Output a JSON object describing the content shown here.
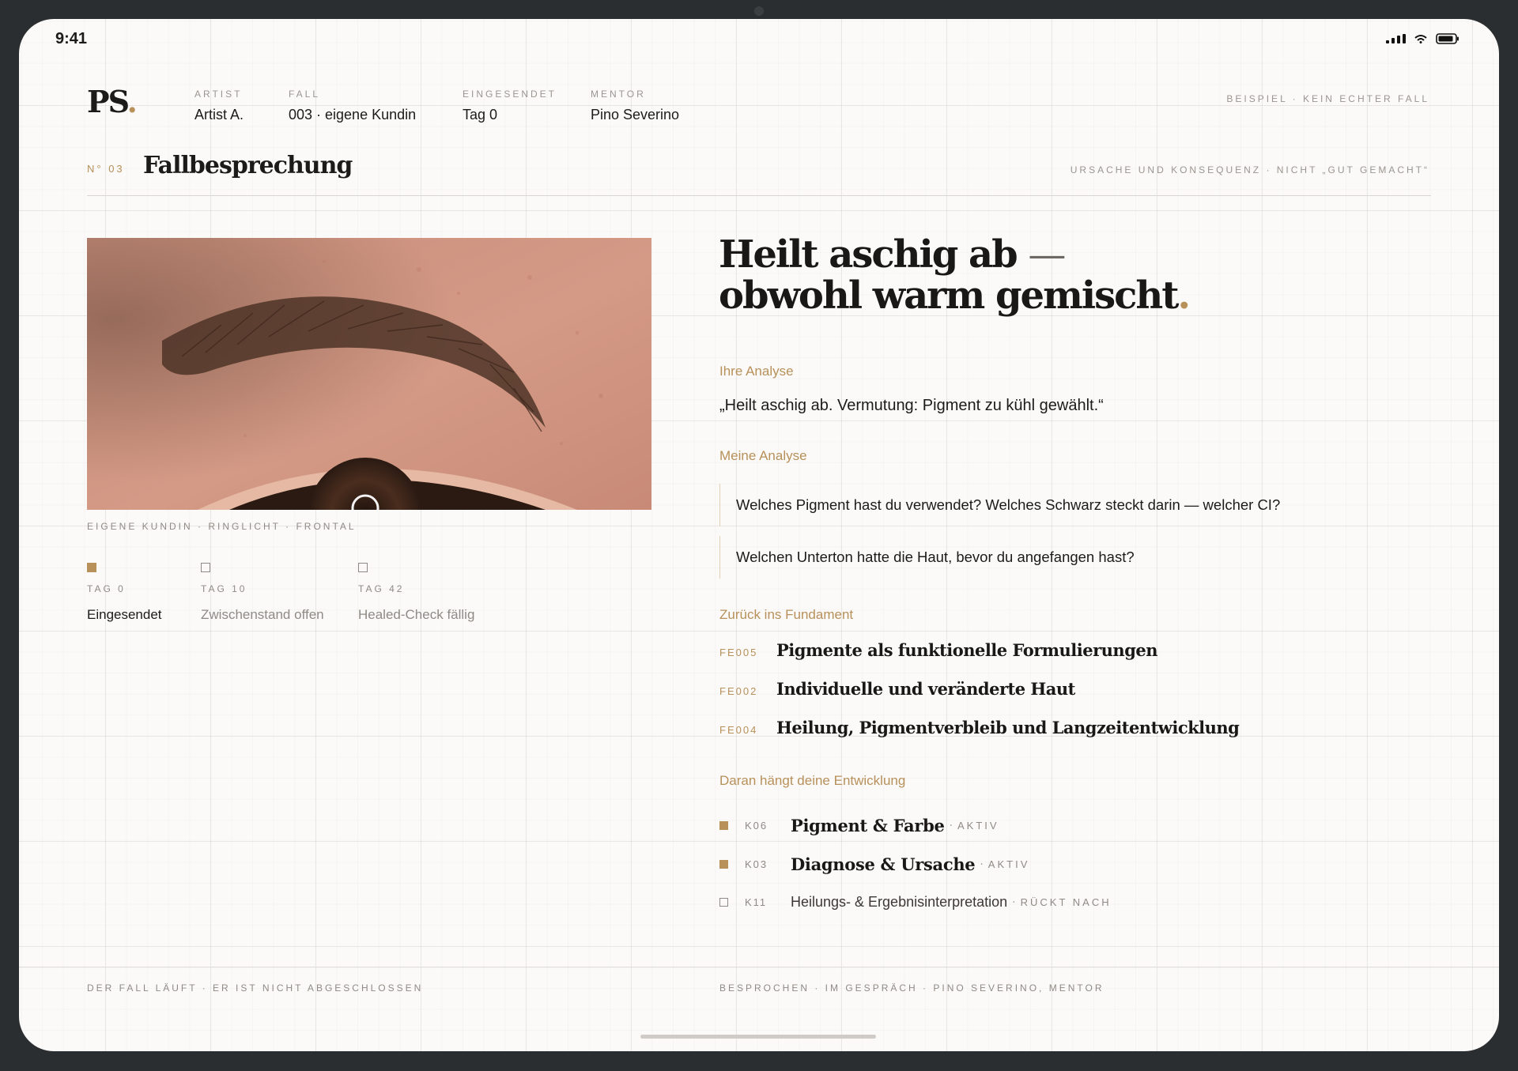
{
  "status_bar": {
    "time": "9:41"
  },
  "header": {
    "logo": "PS",
    "logo_dot": ".",
    "meta": [
      {
        "label": "ARTIST",
        "value": "Artist A."
      },
      {
        "label": "FALL",
        "value": "003 · eigene Kundin"
      },
      {
        "label": "EINGESENDET",
        "value": "Tag 0"
      },
      {
        "label": "MENTOR",
        "value": "Pino Severino"
      }
    ],
    "note": "BEISPIEL · KEIN ECHTER FALL"
  },
  "section": {
    "number": "N° 03",
    "title": "Fallbesprechung",
    "note": "URSACHE UND KONSEQUENZ · NICHT „GUT GEMACHT“"
  },
  "photo": {
    "icon": "eyebrow-photo",
    "caption": "EIGENE KUNDIN · RINGLICHT · FRONTAL"
  },
  "timeline": [
    {
      "day": "TAG 0",
      "status": "Eingesendet",
      "state": "done"
    },
    {
      "day": "TAG 10",
      "status": "Zwischenstand offen",
      "state": "open"
    },
    {
      "day": "TAG 42",
      "status": "Healed-Check fällig",
      "state": "open"
    }
  ],
  "headline": {
    "line1": "Heilt aschig ab",
    "dash": "—",
    "line2": "obwohl warm gemischt",
    "dot": "."
  },
  "your_analysis": {
    "label": "Ihre Analyse",
    "quote": "„Heilt aschig ab. Vermutung: Pigment zu kühl gewählt.“"
  },
  "my_analysis": {
    "label": "Meine Analyse",
    "questions": [
      "Welches Pigment hast du verwendet? Welches Schwarz steckt darin — welcher CI?",
      "Welchen Unterton hatte die Haut, bevor du angefangen hast?"
    ]
  },
  "fundament": {
    "label": "Zurück ins Fundament",
    "items": [
      {
        "code": "FE005",
        "title": "Pigmente als funktionelle Formulierungen"
      },
      {
        "code": "FE002",
        "title": "Individuelle und veränderte Haut"
      },
      {
        "code": "FE004",
        "title": "Heilung, Pigmentverbleib und Langzeitentwicklung"
      }
    ]
  },
  "development": {
    "label": "Daran hängt deine Entwicklung",
    "separator": "·",
    "items": [
      {
        "code": "K06",
        "title": "Pigment & Farbe",
        "state": "AKTIV",
        "active": true
      },
      {
        "code": "K03",
        "title": "Diagnose & Ursache",
        "state": "AKTIV",
        "active": true
      },
      {
        "code": "K11",
        "title": "Heilungs- & Ergebnisinterpretation",
        "state": "RÜCKT NACH",
        "active": false
      }
    ]
  },
  "footer": {
    "left": "DER FALL LÄUFT · ER IST NICHT ABGESCHLOSSEN",
    "right": "BESPROCHEN · IM GESPRÄCH · PINO SEVERINO, MENTOR"
  },
  "colors": {
    "accent": "#b7905a",
    "text": "#1d1b19",
    "muted": "#8f8a85",
    "background": "#fbfaf8",
    "frame": "#2b2e30"
  }
}
